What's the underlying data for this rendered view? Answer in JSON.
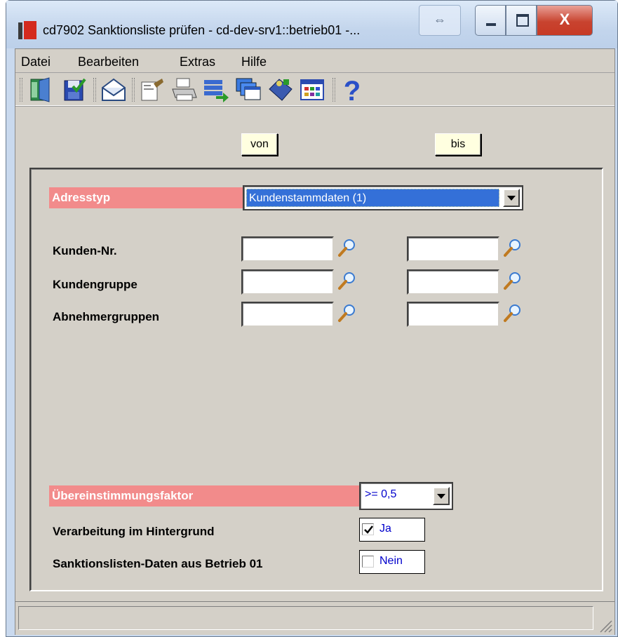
{
  "window": {
    "title": "cd7902 Sanktionsliste prüfen - cd-dev-srv1::betrieb01 -...",
    "close_glyph": "X"
  },
  "menu": {
    "items": [
      "Datei",
      "Bearbeiten",
      "Extras",
      "Hilfe"
    ]
  },
  "toolbar": {
    "icons": [
      "exit-door-icon",
      "save-icon",
      "mail-icon",
      "edit-properties-icon",
      "print-icon",
      "export-list-icon",
      "windows-icon",
      "tag-icon",
      "table-grid-icon",
      "help-icon"
    ]
  },
  "range": {
    "from_label": "von",
    "to_label": "bis"
  },
  "form": {
    "adresstyp_label": "Adresstyp",
    "adresstyp_value": "Kundenstammdaten (1)",
    "kunden_nr_label": "Kunden-Nr.",
    "kundengruppe_label": "Kundengruppe",
    "abnehmergruppen_label": "Abnehmergruppen",
    "faktor_label": "Übereinstimmungsfaktor",
    "faktor_value": ">= 0,5",
    "hintergrund_label": "Verarbeitung im Hintergrund",
    "hintergrund_value": "Ja",
    "hintergrund_checked": true,
    "betrieb_label": "Sanktionslisten-Daten aus Betrieb 01",
    "betrieb_value": "Nein",
    "betrieb_checked": false
  },
  "colors": {
    "required_label_bg": "#f28b8b",
    "selection_bg": "#3470d8",
    "checkbox_text": "#0000cc",
    "header_button_bg": "#ffffe0"
  }
}
